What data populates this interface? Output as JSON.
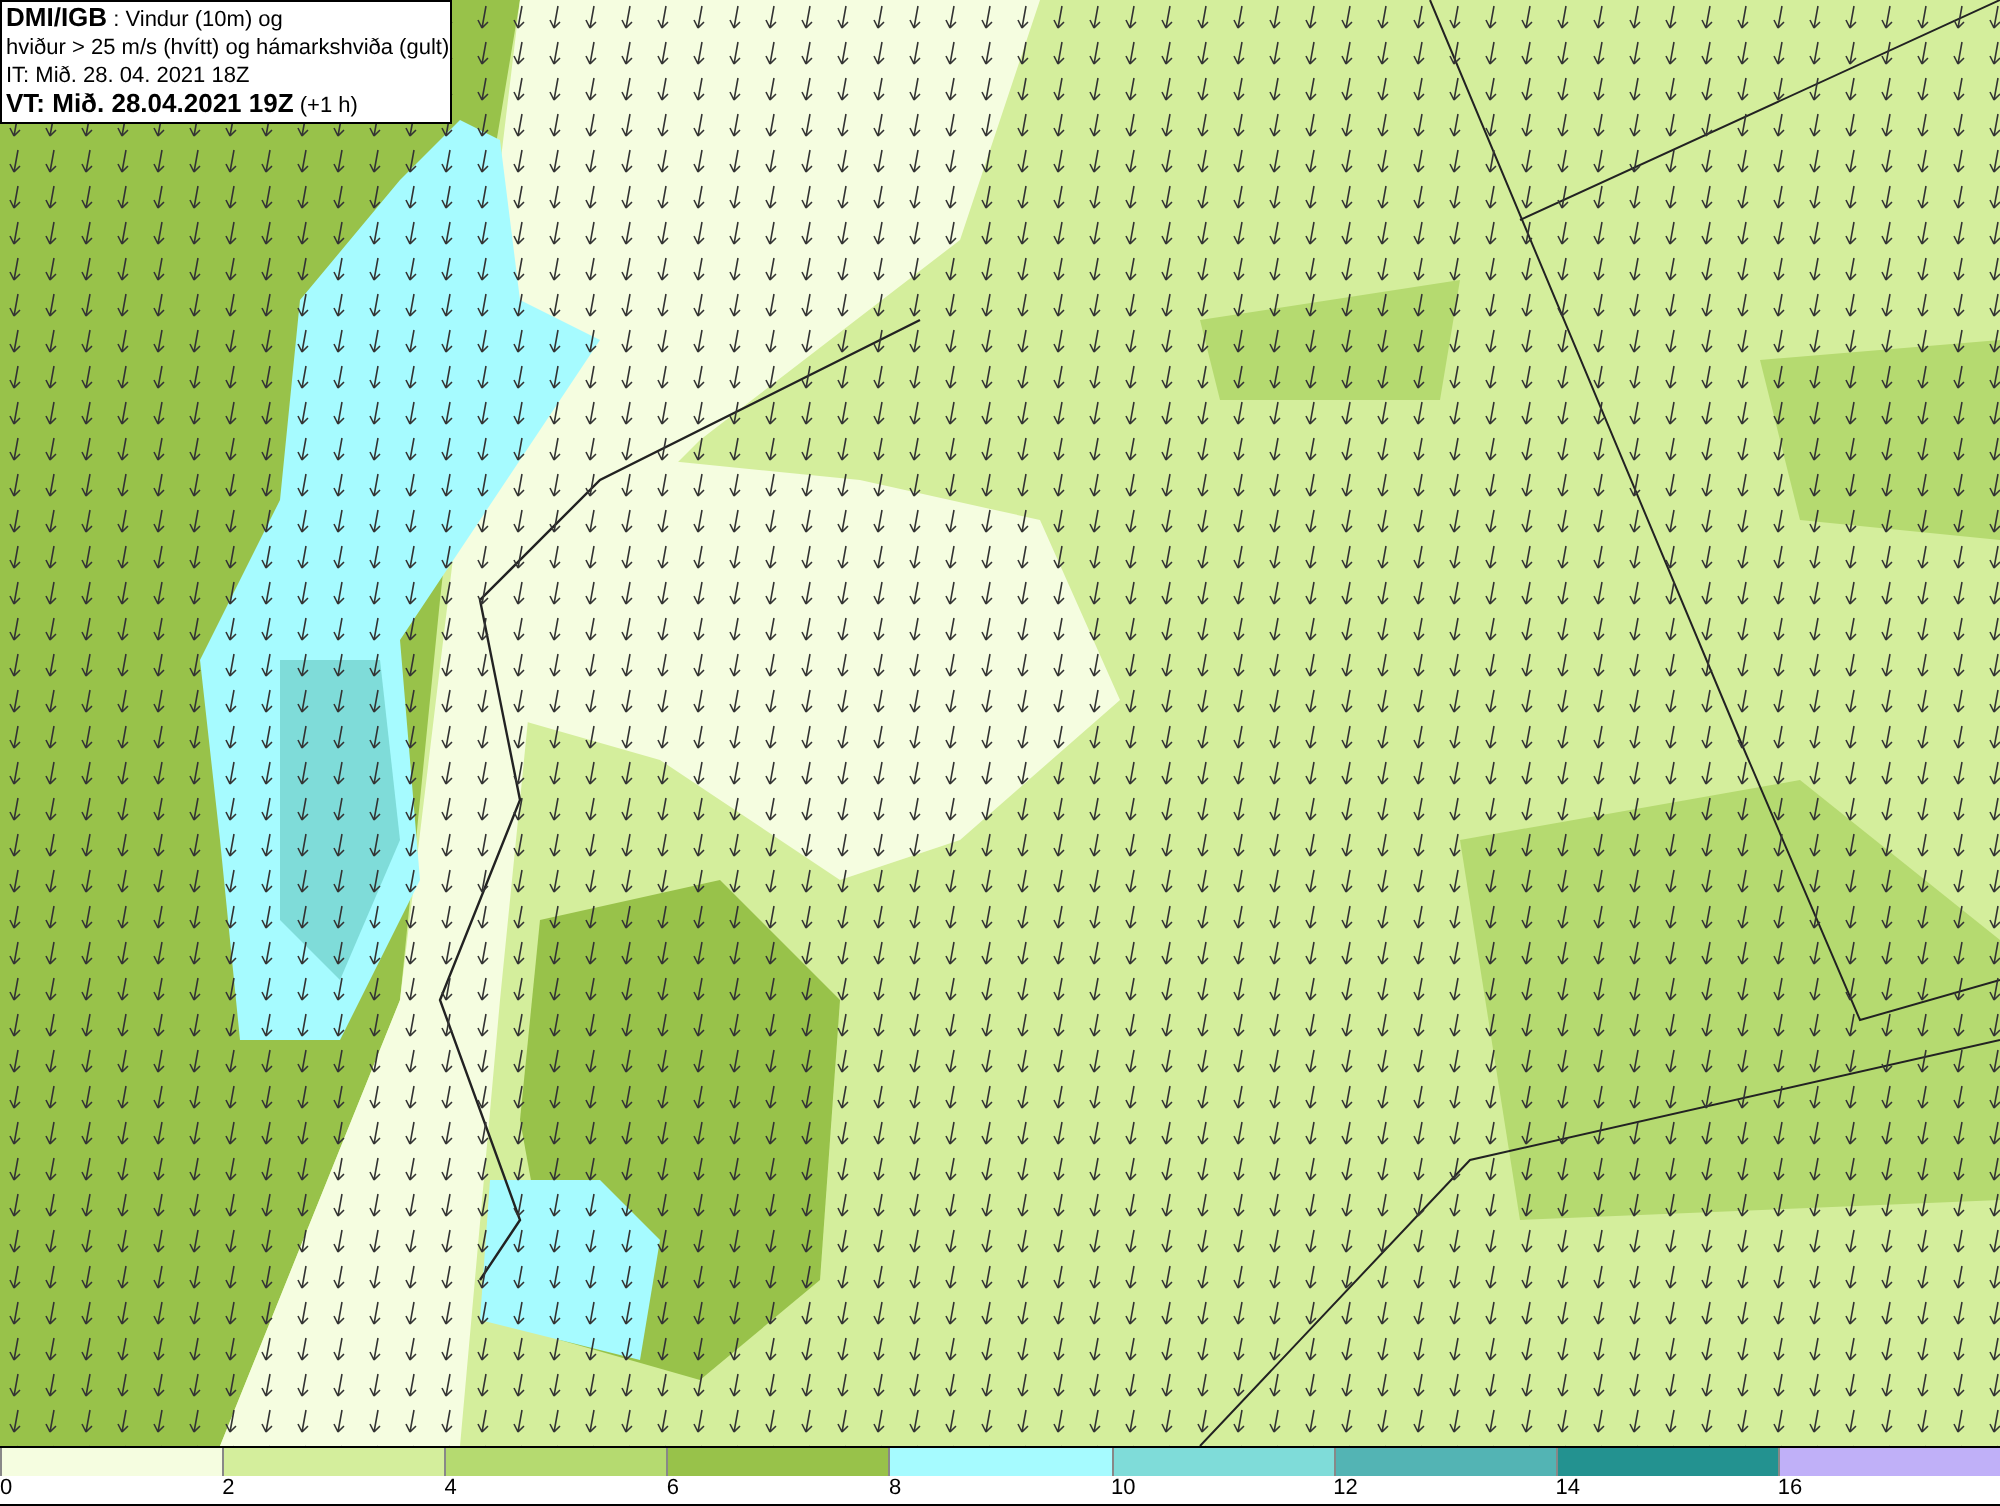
{
  "header": {
    "lines": [
      "**DMI/IGB** : Vindur (10m) og",
      "hviður > 25 m/s (hvítt) og hámarkshviða (gult)",
      "IT: Mið. 28. 04. 2021 18Z",
      "**VT: Mið. 28.04.2021 19Z** (+1 h)"
    ]
  },
  "legend": [
    {
      "label": "0",
      "color": "#f5fde0"
    },
    {
      "label": "2",
      "color": "#d4ee9c"
    },
    {
      "label": "4",
      "color": "#b5da70"
    },
    {
      "label": "6",
      "color": "#98c24a"
    },
    {
      "label": "8",
      "color": "#a6fbff"
    },
    {
      "label": "10",
      "color": "#7fdcd9"
    },
    {
      "label": "12",
      "color": "#53b4b4"
    },
    {
      "label": "14",
      "color": "#239290"
    },
    {
      "label": "16",
      "color": "#c0b0f8"
    }
  ]
}
